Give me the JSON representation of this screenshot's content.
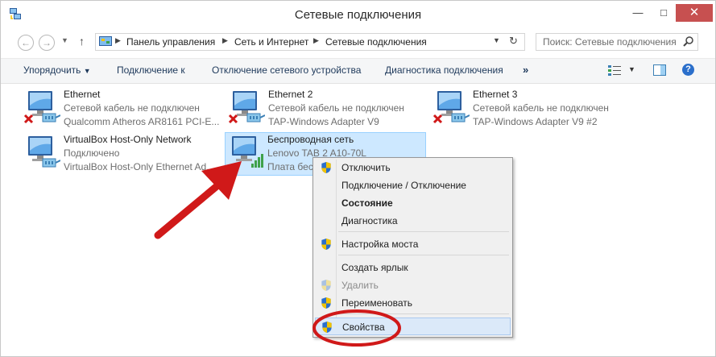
{
  "window": {
    "title": "Сетевые подключения",
    "minimize_glyph": "—",
    "maximize_glyph": "□",
    "close_glyph": "✕"
  },
  "addressbar": {
    "back_glyph": "←",
    "forward_glyph": "→",
    "up_glyph": "↑",
    "breadcrumbs": [
      "Панель управления",
      "Сеть и Интернет",
      "Сетевые подключения"
    ],
    "search_placeholder": "Поиск: Сетевые подключения"
  },
  "toolbar": {
    "organize": "Упорядочить",
    "connect_to": "Подключение к",
    "disable_device": "Отключение сетевого устройства",
    "diagnose": "Диагностика подключения",
    "more": "»",
    "help": "?"
  },
  "connections": [
    {
      "name": "Ethernet",
      "status": "Сетевой кабель не подключен",
      "device": "Qualcomm Atheros AR8161 PCI-E...",
      "state": "disconnected"
    },
    {
      "name": "Ethernet 2",
      "status": "Сетевой кабель не подключен",
      "device": "TAP-Windows Adapter V9",
      "state": "disconnected"
    },
    {
      "name": "Ethernet 3",
      "status": "Сетевой кабель не подключен",
      "device": "TAP-Windows Adapter V9 #2",
      "state": "disconnected"
    },
    {
      "name": "VirtualBox Host-Only Network",
      "status": "Подключено",
      "device": "VirtualBox Host-Only Ethernet Ad...",
      "state": "connected"
    },
    {
      "name": "Беспроводная сеть",
      "status": "Lenovo TAB 2 A10-70L",
      "device": "Плата беспр...",
      "state": "wireless"
    }
  ],
  "context_menu": {
    "items": [
      {
        "label": "Отключить",
        "shield": true
      },
      {
        "label": "Подключение / Отключение",
        "shield": false
      },
      {
        "label": "Состояние",
        "shield": false
      },
      {
        "label": "Диагностика",
        "shield": false
      },
      {
        "label": "Настройка моста",
        "shield": true
      },
      {
        "label": "Создать ярлык",
        "shield": false
      },
      {
        "label": "Удалить",
        "shield": true
      },
      {
        "label": "Переименовать",
        "shield": true
      },
      {
        "label": "Свойства",
        "shield": true
      }
    ]
  },
  "colors": {
    "annotation_red": "#d01919",
    "selection_bg": "#cde8ff",
    "menu_highlight": "#dbe9f9",
    "close_button": "#c75050"
  }
}
